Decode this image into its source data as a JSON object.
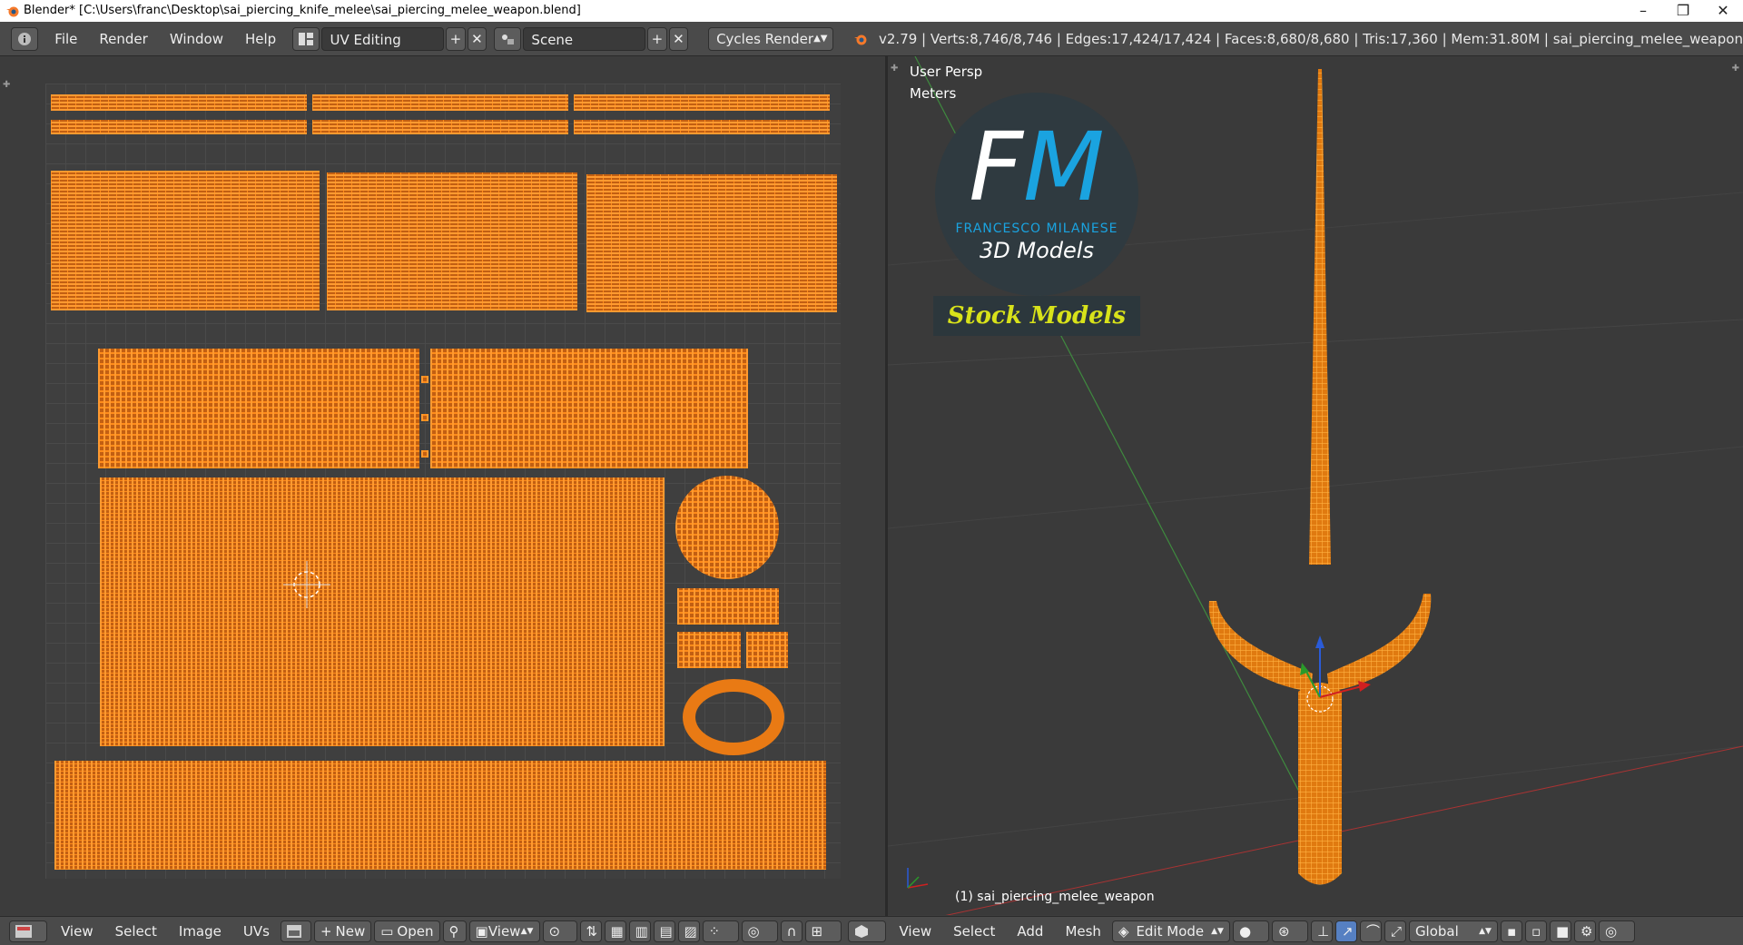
{
  "window": {
    "title": "Blender* [C:\\Users\\franc\\Desktop\\sai_piercing_knife_melee\\sai_piercing_melee_weapon.blend]",
    "controls": [
      "–",
      "❐",
      "✕"
    ]
  },
  "topbar": {
    "menus": [
      "File",
      "Render",
      "Window",
      "Help"
    ],
    "screen_layout": "UV Editing",
    "scene": "Scene",
    "render_engine": "Cycles Render",
    "stats": "v2.79 | Verts:8,746/8,746 | Edges:17,424/17,424 | Faces:8,680/8,680 | Tris:17,360 | Mem:31.80M | sai_piercing_melee_weapon"
  },
  "viewport": {
    "view_label": "User Persp",
    "units_label": "Meters",
    "object_label": "(1) sai_piercing_melee_weapon",
    "logo": {
      "letters_f": "F",
      "letters_m": "M",
      "brand": "FRANCESCO MILANESE",
      "subtitle": "3D Models",
      "banner": "Stock Models"
    }
  },
  "uv_header": {
    "menus": [
      "View",
      "Select",
      "Image",
      "UVs"
    ],
    "new_label": "New",
    "open_label": "Open",
    "view_label": "View"
  },
  "view3d_header": {
    "menus": [
      "View",
      "Select",
      "Add",
      "Mesh"
    ],
    "mode": "Edit Mode",
    "orientation": "Global"
  },
  "colors": {
    "mesh_orange": "#ff9a30",
    "accent_blue": "#1aa3e0",
    "banner_yellow": "#d8e21a"
  }
}
